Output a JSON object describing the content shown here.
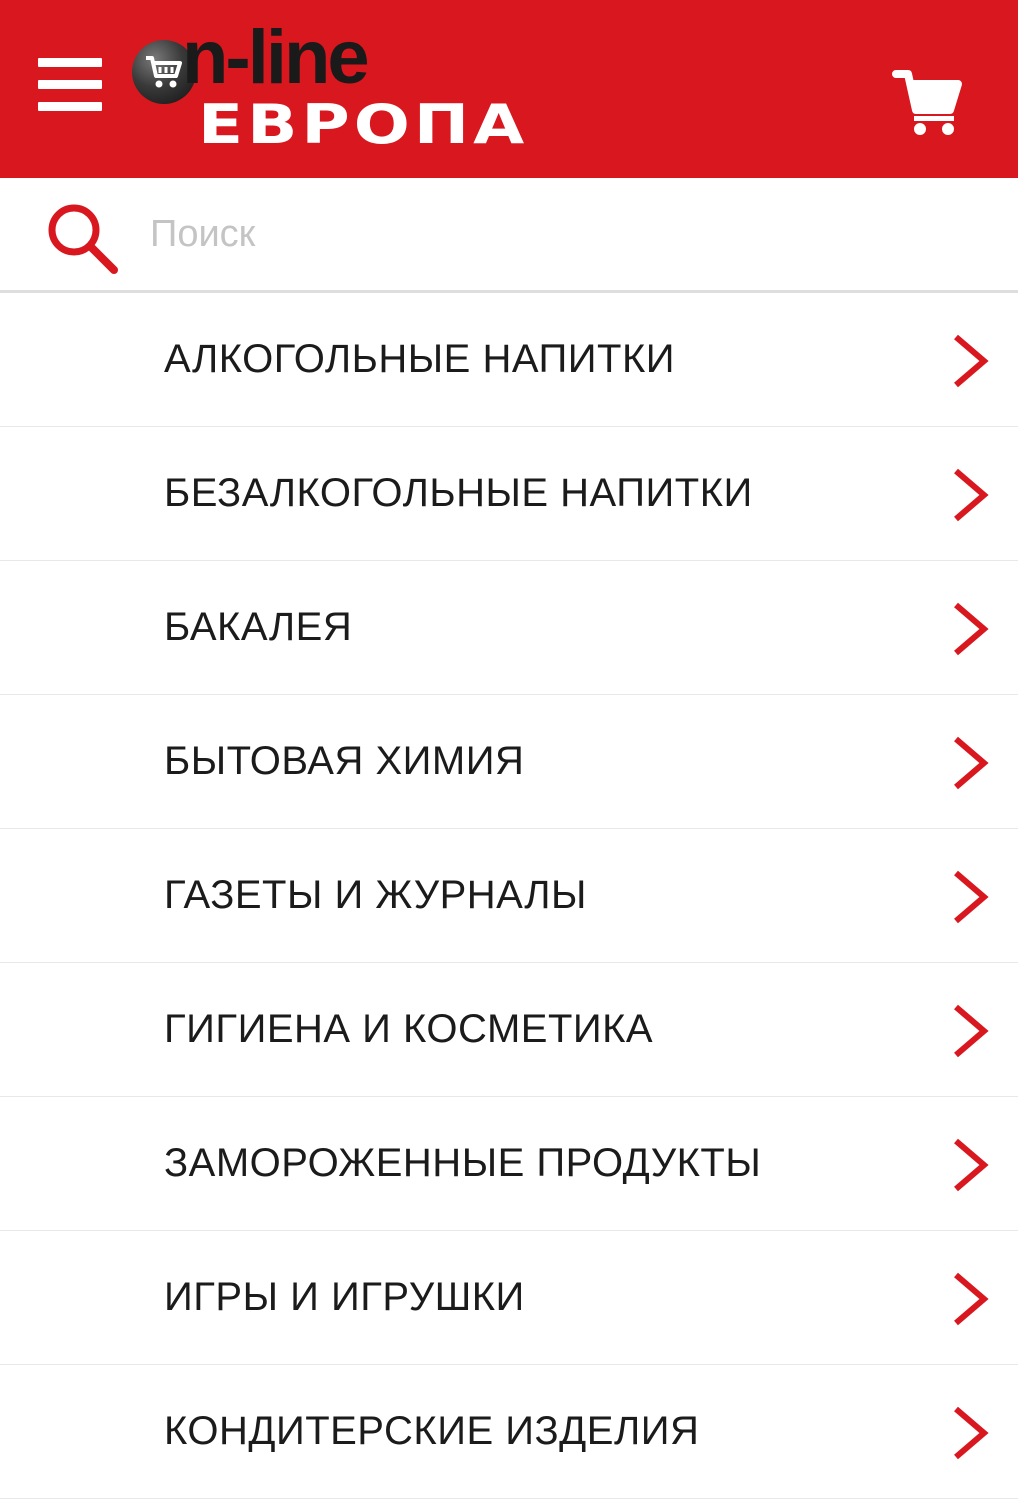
{
  "header": {
    "logo": {
      "line1": "n-line",
      "line2": "ЕВРОПА"
    },
    "menu_icon": "hamburger-menu-icon",
    "cart_icon": "shopping-cart-icon"
  },
  "search": {
    "placeholder": "Поиск",
    "icon": "search-icon"
  },
  "categories": [
    {
      "label": "АЛКОГОЛЬНЫЕ НАПИТКИ"
    },
    {
      "label": "БЕЗАЛКОГОЛЬНЫЕ НАПИТКИ"
    },
    {
      "label": "БАКАЛЕЯ"
    },
    {
      "label": "БЫТОВАЯ ХИМИЯ"
    },
    {
      "label": "ГАЗЕТЫ И ЖУРНАЛЫ"
    },
    {
      "label": "ГИГИЕНА И КОСМЕТИКА"
    },
    {
      "label": "ЗАМОРОЖЕННЫЕ ПРОДУКТЫ"
    },
    {
      "label": "ИГРЫ И ИГРУШКИ"
    },
    {
      "label": "КОНДИТЕРСКИЕ ИЗДЕЛИЯ"
    }
  ],
  "colors": {
    "brand_red": "#d9171e",
    "text": "#1b1b1b",
    "placeholder": "#c4c4c4",
    "divider": "#e8e8e8"
  }
}
